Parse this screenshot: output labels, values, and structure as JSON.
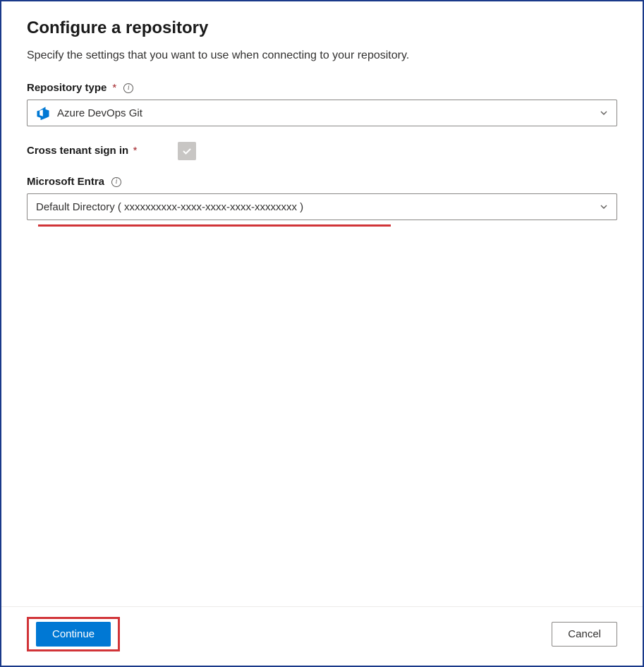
{
  "header": {
    "title": "Configure a repository",
    "description": "Specify the settings that you want to use when connecting to your repository."
  },
  "fields": {
    "repositoryType": {
      "label": "Repository type",
      "value": "Azure DevOps Git"
    },
    "crossTenant": {
      "label": "Cross tenant sign in",
      "checked": true
    },
    "microsoftEntra": {
      "label": "Microsoft Entra",
      "value": "Default Directory ( xxxxxxxxxx-xxxx-xxxx-xxxx-xxxxxxxx )"
    }
  },
  "footer": {
    "continue": "Continue",
    "cancel": "Cancel"
  }
}
